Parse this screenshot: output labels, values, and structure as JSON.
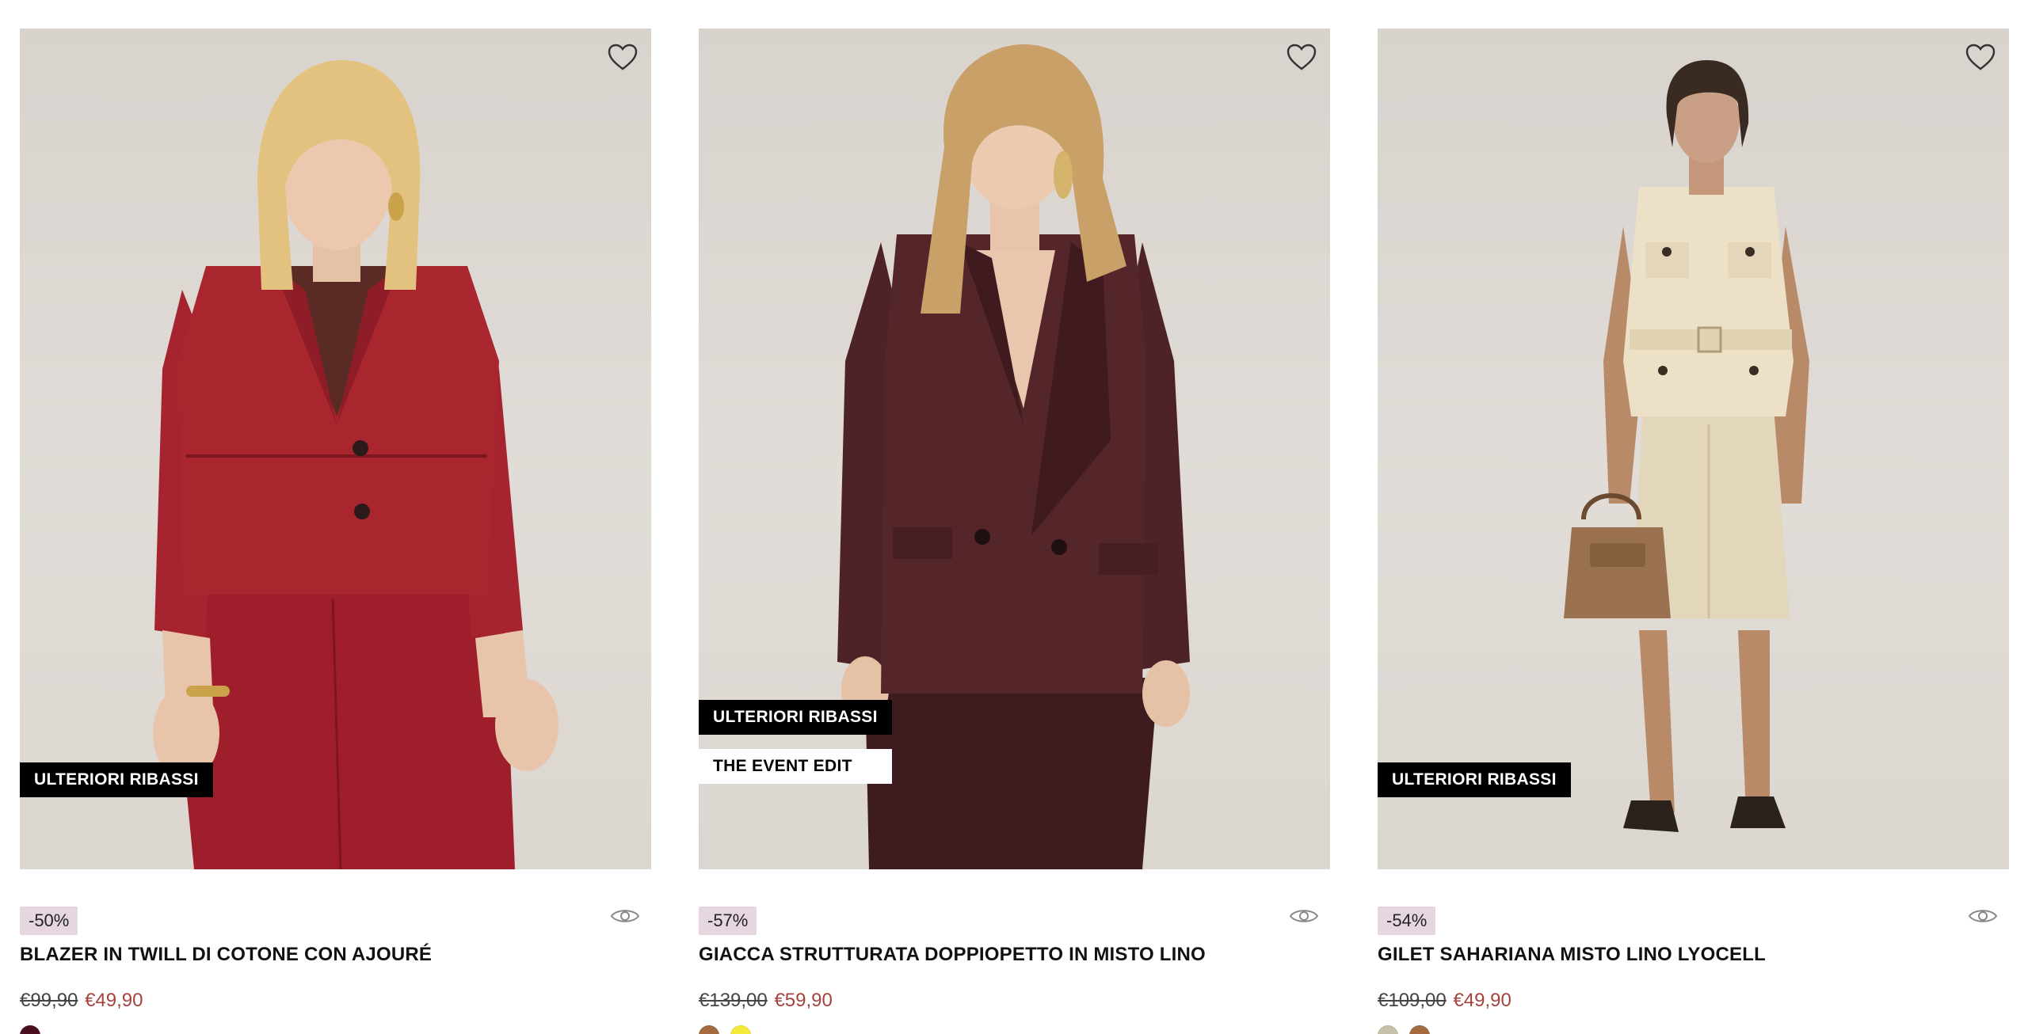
{
  "products": [
    {
      "badges": [
        "ULTERIORI RIBASSI"
      ],
      "discount": "-50%",
      "title": "BLAZER IN TWILL DI COTONE CON AJOURÉ",
      "old_price": "€99,90",
      "new_price": "€49,90",
      "swatches": [
        "#4a0e1e"
      ],
      "wishlist_icon": "heart-icon",
      "quickview_icon": "eye-icon"
    },
    {
      "badges": [
        "ULTERIORI RIBASSI",
        "THE EVENT EDIT"
      ],
      "discount": "-57%",
      "title": "GIACCA STRUTTURATA DOPPIOPETTO IN MISTO LINO",
      "old_price": "€139,00",
      "new_price": "€59,90",
      "swatches": [
        "#a56a3f",
        "#f4ea3a"
      ],
      "wishlist_icon": "heart-icon",
      "quickview_icon": "eye-icon"
    },
    {
      "badges": [
        "ULTERIORI RIBASSI"
      ],
      "discount": "-54%",
      "title": "GILET SAHARIANA MISTO LINO LYOCELL",
      "old_price": "€109,00",
      "new_price": "€49,90",
      "swatches": [
        "#c6c0a9",
        "#a56a3f"
      ],
      "wishlist_icon": "heart-icon",
      "quickview_icon": "eye-icon"
    }
  ],
  "colors": {
    "sale_price": "#a4433e",
    "discount_bg": "#e5d6df",
    "badge_dark": "#000000",
    "badge_light": "#ffffff",
    "outfit_1": "#a5242f",
    "outfit_2": "#4a2226",
    "outfit_3": "#e9dcc2"
  }
}
